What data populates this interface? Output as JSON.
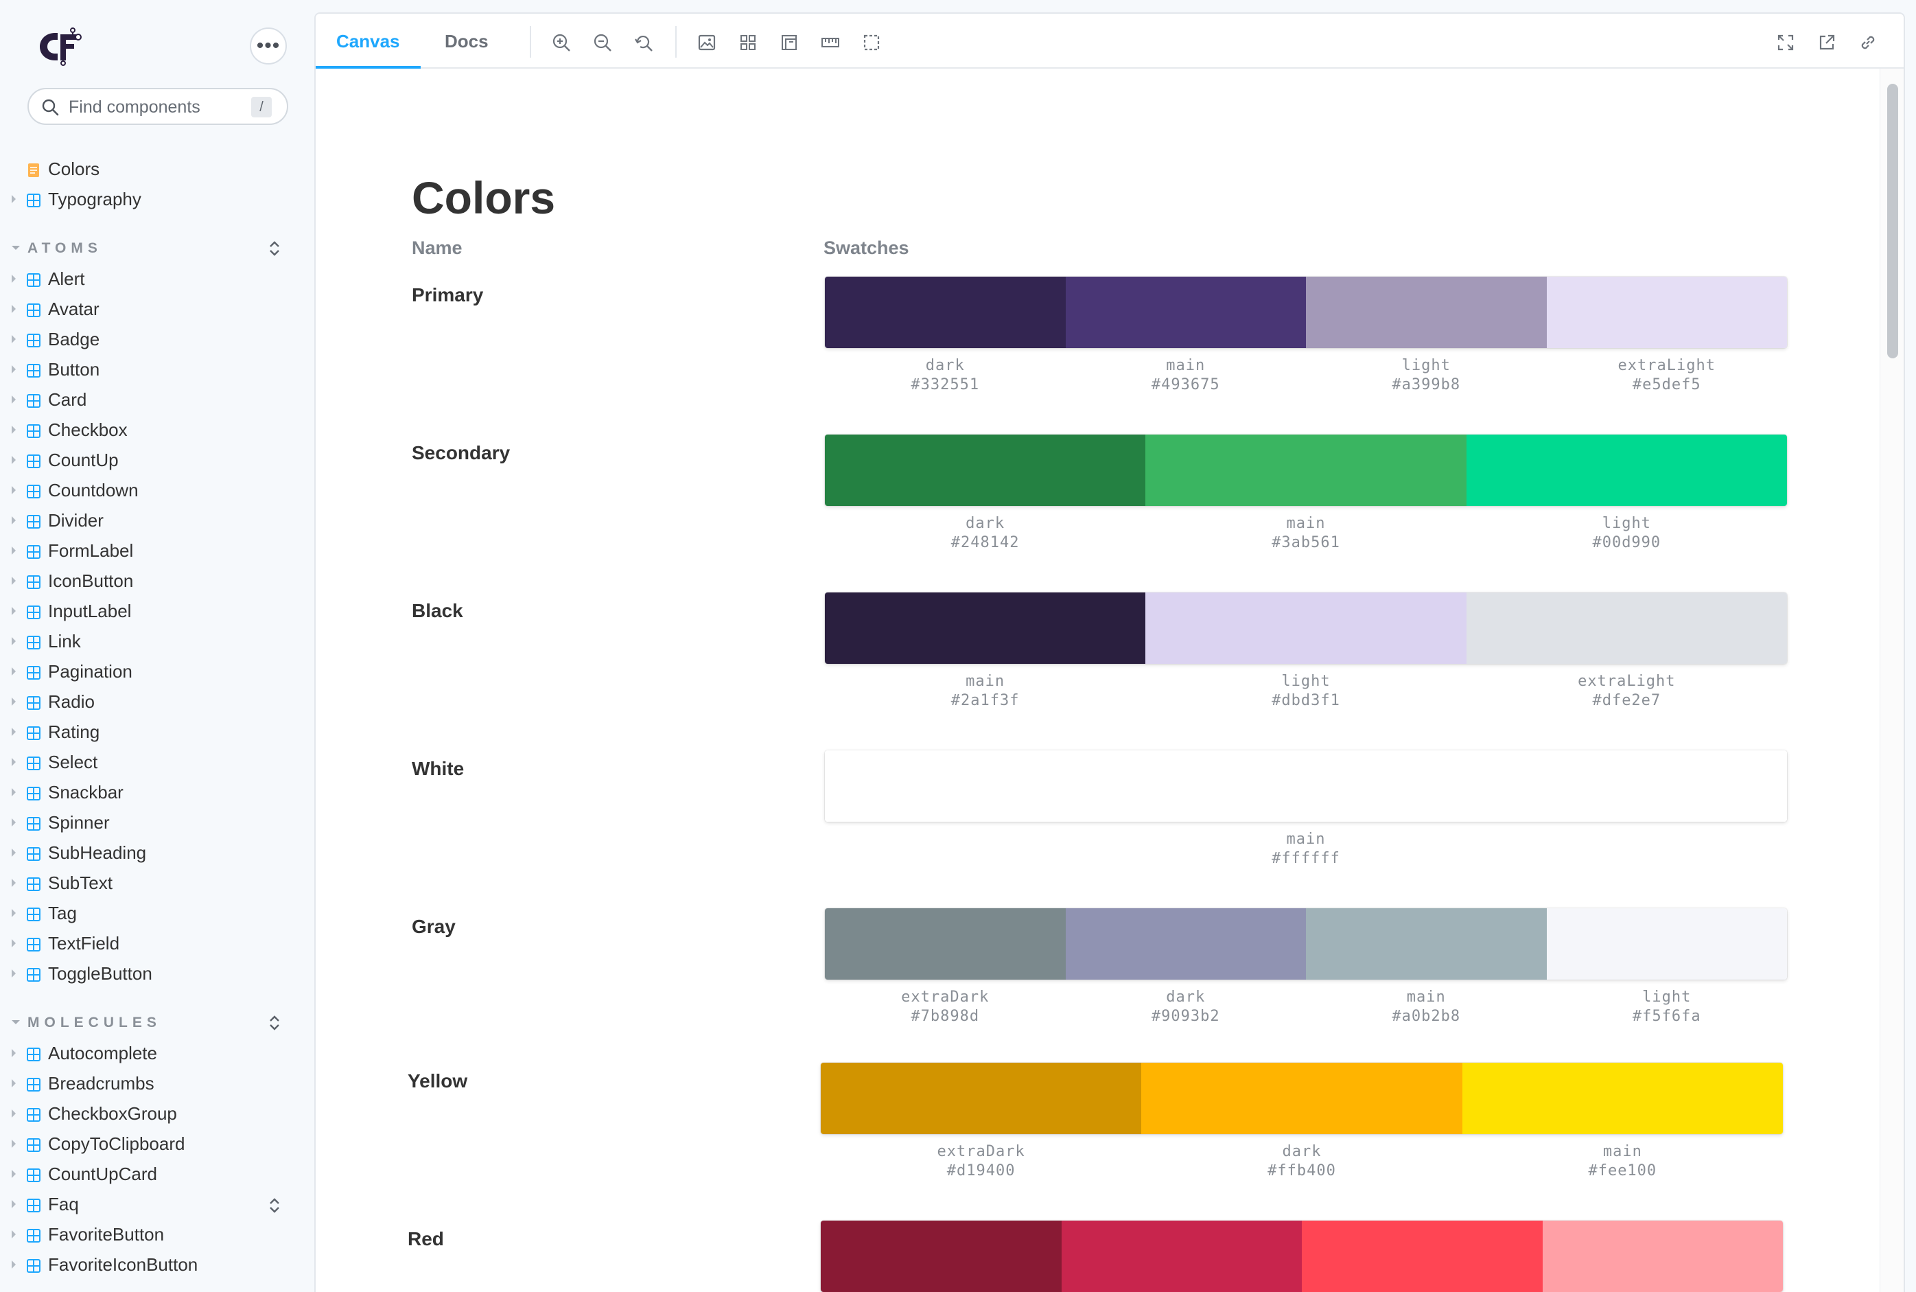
{
  "sidebar": {
    "menu_label": "•••",
    "search": {
      "placeholder": "Find components",
      "shortcut": "/"
    },
    "top_items": [
      {
        "label": "Colors",
        "icon": "document-icon"
      },
      {
        "label": "Typography",
        "icon": "component-icon"
      }
    ],
    "sections": [
      {
        "title": "ATOMS",
        "items": [
          "Alert",
          "Avatar",
          "Badge",
          "Button",
          "Card",
          "Checkbox",
          "CountUp",
          "Countdown",
          "Divider",
          "FormLabel",
          "IconButton",
          "InputLabel",
          "Link",
          "Pagination",
          "Radio",
          "Rating",
          "Select",
          "Snackbar",
          "Spinner",
          "SubHeading",
          "SubText",
          "Tag",
          "TextField",
          "ToggleButton"
        ]
      },
      {
        "title": "MOLECULES",
        "items": [
          "Autocomplete",
          "Breadcrumbs",
          "CheckboxGroup",
          "CopyToClipboard",
          "CountUpCard",
          "Faq",
          "FavoriteButton",
          "FavoriteIconButton"
        ]
      }
    ]
  },
  "toolbar": {
    "tabs": [
      {
        "label": "Canvas",
        "active": true
      },
      {
        "label": "Docs",
        "active": false
      }
    ],
    "tools": [
      "zoom-in-icon",
      "zoom-out-icon",
      "reset-zoom-icon",
      "background-icon",
      "grid-icon",
      "viewport-icon",
      "measure-icon",
      "outline-icon"
    ],
    "right_tools": [
      "fullscreen-icon",
      "open-new-tab-icon",
      "copy-link-icon"
    ]
  },
  "page": {
    "title": "Colors",
    "col_name": "Name",
    "col_swatches": "Swatches",
    "colors": [
      {
        "name": "Primary",
        "swatches": [
          {
            "label": "dark",
            "hex": "#332551"
          },
          {
            "label": "main",
            "hex": "#493675"
          },
          {
            "label": "light",
            "hex": "#a399b8"
          },
          {
            "label": "extraLight",
            "hex": "#e5def5"
          }
        ]
      },
      {
        "name": "Secondary",
        "swatches": [
          {
            "label": "dark",
            "hex": "#248142"
          },
          {
            "label": "main",
            "hex": "#3ab561"
          },
          {
            "label": "light",
            "hex": "#00d990"
          }
        ]
      },
      {
        "name": "Black",
        "swatches": [
          {
            "label": "main",
            "hex": "#2a1f3f"
          },
          {
            "label": "light",
            "hex": "#dbd3f1"
          },
          {
            "label": "extraLight",
            "hex": "#dfe2e7"
          }
        ]
      },
      {
        "name": "White",
        "swatches": [
          {
            "label": "main",
            "hex": "#ffffff"
          }
        ]
      },
      {
        "name": "Gray",
        "swatches": [
          {
            "label": "extraDark",
            "hex": "#7b898d"
          },
          {
            "label": "dark",
            "hex": "#9093b2"
          },
          {
            "label": "main",
            "hex": "#a0b2b8"
          },
          {
            "label": "light",
            "hex": "#f5f6fa"
          }
        ]
      },
      {
        "name": "Yellow",
        "swatches": [
          {
            "label": "extraDark",
            "hex": "#d19400"
          },
          {
            "label": "dark",
            "hex": "#ffb400"
          },
          {
            "label": "main",
            "hex": "#fee100"
          }
        ]
      },
      {
        "name": "Red",
        "swatches": [
          {
            "label": "",
            "hex": "#891a34"
          },
          {
            "label": "",
            "hex": "#c8254d"
          },
          {
            "label": "",
            "hex": "#ff4554"
          },
          {
            "label": "",
            "hex": "#ffa0a6"
          }
        ],
        "hide_labels": true
      }
    ]
  }
}
